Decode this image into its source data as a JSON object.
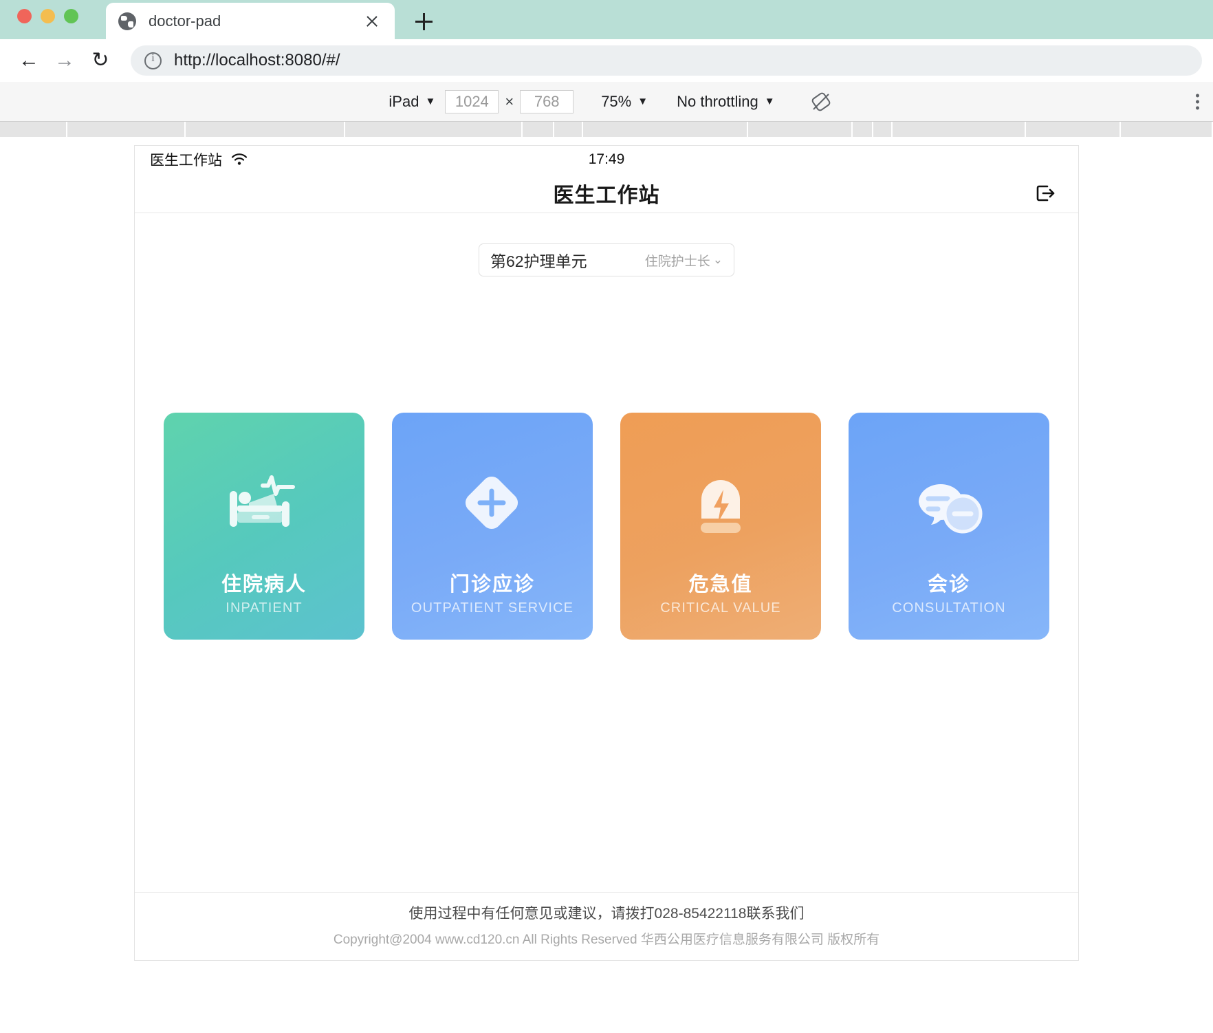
{
  "browser": {
    "tab": {
      "title": "doctor-pad",
      "favicon_icon": "globe-icon",
      "close_icon": "close-icon"
    },
    "new_tab_icon": "plus-icon",
    "nav": {
      "back_icon": "arrow-left-icon",
      "forward_icon": "arrow-right-icon",
      "reload_icon": "reload-icon"
    },
    "address": {
      "value": "http://localhost:8080/#/",
      "security_icon": "info-circle-icon"
    }
  },
  "device_toolbar": {
    "device": "iPad",
    "device_caret": "▼",
    "width": "1024",
    "height": "768",
    "times": "×",
    "zoom": "75%",
    "zoom_caret": "▼",
    "throttling": "No throttling",
    "throttling_caret": "▼",
    "rotate_icon": "rotate-device-icon",
    "more_icon": "kebab-menu-icon"
  },
  "app": {
    "status_bar": {
      "carrier": "医生工作站",
      "wifi_icon": "wifi-icon",
      "time": "17:49"
    },
    "header": {
      "title": "医生工作站",
      "logout_icon": "logout-icon"
    },
    "ward_selector": {
      "unit": "第62护理单元",
      "role": "住院护士长",
      "chevron_icon": "chevron-down-icon"
    },
    "cards": [
      {
        "cn": "住院病人",
        "en": "INPATIENT",
        "icon": "hospital-bed-ecg-icon",
        "color": "#5fd3ad",
        "theme": "green"
      },
      {
        "cn": "门诊应诊",
        "en": "OUTPATIENT SERVICE",
        "icon": "diamond-plus-icon",
        "color": "#6ca4f7",
        "theme": "blue"
      },
      {
        "cn": "危急值",
        "en": "CRITICAL VALUE",
        "icon": "alarm-beacon-bolt-icon",
        "color": "#ef9d55",
        "theme": "orange"
      },
      {
        "cn": "会诊",
        "en": "CONSULTATION",
        "icon": "chat-bubbles-icon",
        "color": "#6ca4f7",
        "theme": "blue2"
      }
    ],
    "footer": {
      "line1": "使用过程中有任何意见或建议，请拨打028-85422118联系我们",
      "line2": "Copyright@2004 www.cd120.cn All Rights Reserved 华西公用医疗信息服务有限公司 版权所有"
    }
  }
}
